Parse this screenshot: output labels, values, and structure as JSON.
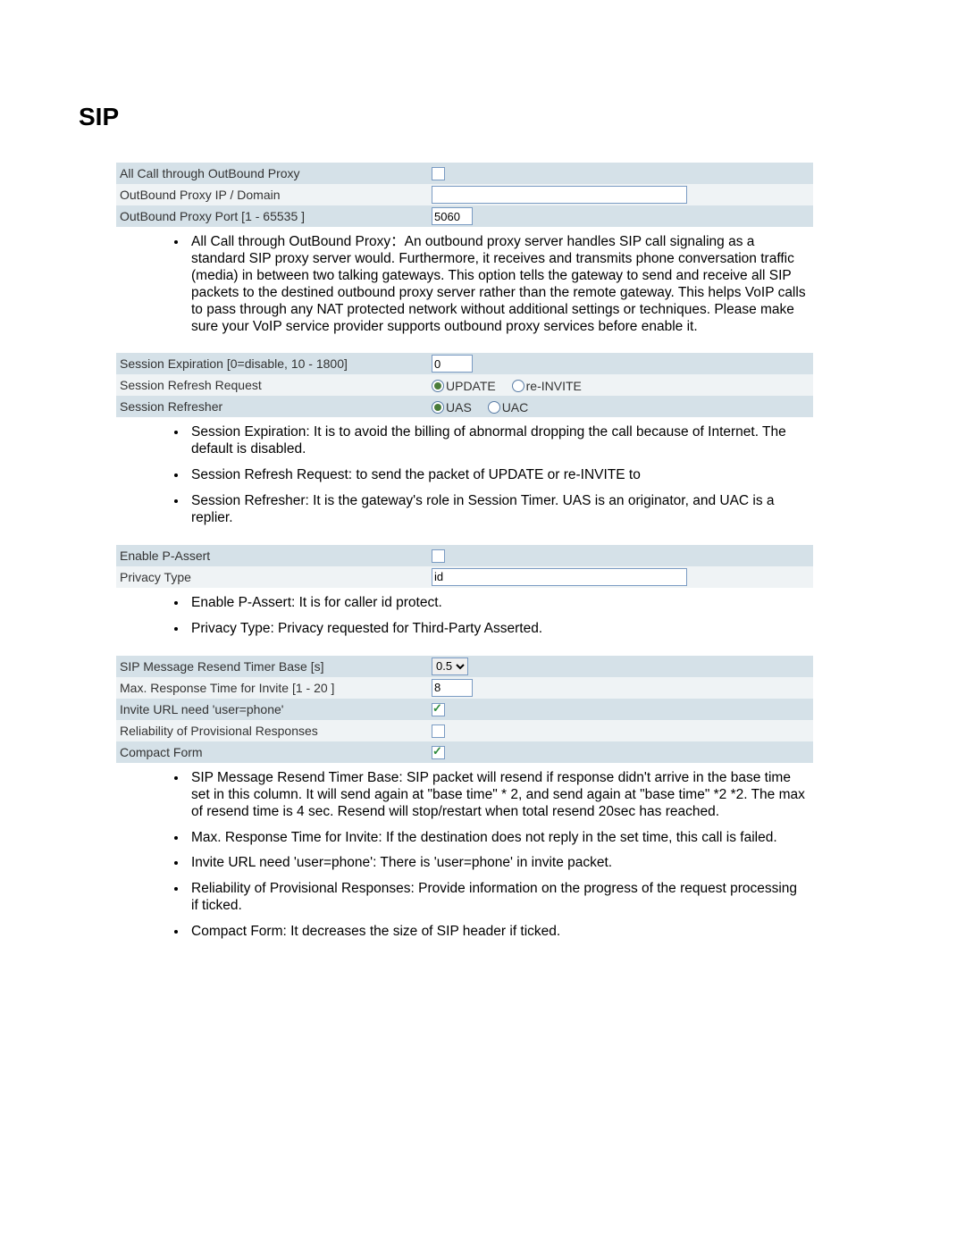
{
  "title": "SIP",
  "table1": {
    "rows": [
      "All Call through OutBound Proxy",
      "OutBound Proxy IP / Domain",
      "OutBound Proxy Port [1 - 65535 ]"
    ],
    "outbound_proxy_checked": false,
    "domain_value": "",
    "port_value": "5060"
  },
  "desc1": [
    "All Call through OutBound Proxy：An outbound proxy server handles SIP call signaling as a standard SIP proxy server would.    Furthermore, it receives and transmits phone conversation traffic (media) in between two talking gateways. This option tells the gateway to send and receive all SIP packets to the destined outbound proxy server rather than the remote gateway. This helps VoIP calls to pass through any NAT protected network without additional settings or techniques. Please make sure your VoIP service provider supports outbound proxy services before enable it."
  ],
  "table2": {
    "rows": [
      "Session Expiration [0=disable, 10 - 1800]",
      "Session Refresh Request",
      "Session Refresher"
    ],
    "expiration_value": "0",
    "refresh_request": {
      "options": [
        "UPDATE",
        "re-INVITE"
      ],
      "selected": "UPDATE"
    },
    "refresher": {
      "options": [
        "UAS",
        "UAC"
      ],
      "selected": "UAS"
    }
  },
  "desc2": [
    "Session Expiration: It is to avoid the billing of abnormal dropping the call because of Internet. The default is disabled.",
    "Session Refresh Request: to send the packet of UPDATE or re-INVITE to",
    "Session Refresher: It is the gateway's role in Session Timer. UAS is an originator, and UAC is a replier."
  ],
  "table3": {
    "rows": [
      "Enable P-Assert",
      "Privacy Type"
    ],
    "p_assert_checked": false,
    "privacy_value": "id"
  },
  "desc3": [
    "Enable P-Assert: It is for caller id protect.",
    "Privacy Type: Privacy requested for Third-Party Asserted."
  ],
  "table4": {
    "rows": [
      "SIP Message Resend Timer Base [s]",
      "Max. Response Time for Invite [1 - 20 ]",
      "Invite URL need 'user=phone'",
      "Reliability of Provisional Responses",
      "Compact Form"
    ],
    "resend_timer_value": "0.5",
    "max_response_value": "8",
    "invite_url_checked": true,
    "reliability_checked": false,
    "compact_form_checked": true
  },
  "desc4": [
    "SIP Message Resend Timer Base: SIP packet will resend if response didn't arrive in the base time set in this column. It will send again at \"base time\" * 2, and send again at \"base time\" *2 *2. The max of resend time is 4 sec. Resend will stop/restart when total resend 20sec has reached.",
    "Max. Response Time for Invite: If the destination does not reply in the set time, this call is failed.",
    "Invite URL need 'user=phone': There is 'user=phone' in invite packet.",
    "Reliability of Provisional Responses: Provide information on the progress of the request processing if ticked.",
    "Compact Form: It decreases the size of SIP header if ticked."
  ]
}
